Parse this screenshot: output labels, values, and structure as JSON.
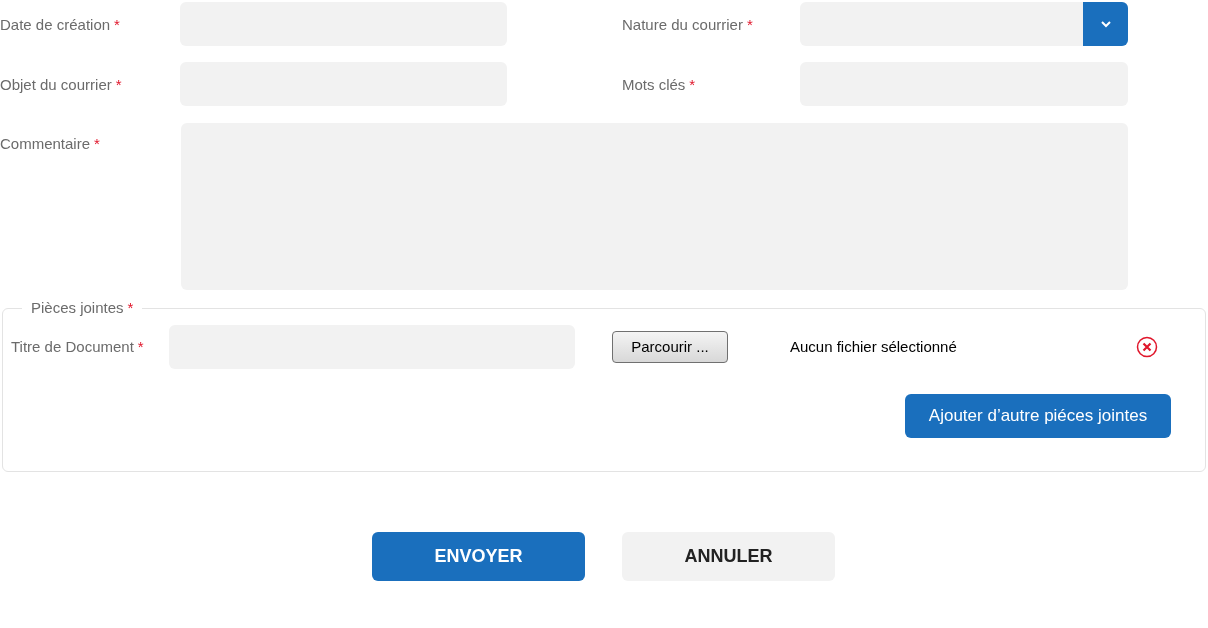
{
  "fields": [
    {
      "label": "Date de création",
      "required_mark": "*",
      "kind": "text"
    },
    {
      "label": "Nature du courrier",
      "required_mark": "*",
      "kind": "select"
    },
    {
      "label": "Objet du courrier",
      "required_mark": "*",
      "kind": "text"
    },
    {
      "label": "Mots clés",
      "required_mark": "*",
      "kind": "text"
    }
  ],
  "comment": {
    "label": "Commentaire",
    "required_mark": "*"
  },
  "attachments": {
    "legend": "Pièces jointes",
    "required_mark": "*",
    "title_label": "Titre de Document",
    "title_required_mark": "*",
    "browse_button": "Parcourir ...",
    "file_status": "Aucun fichier sélectionné",
    "add_button": "Ajouter d’autre piéces jointes"
  },
  "actions": [
    {
      "label": "ENVOYER",
      "kind": "primary"
    },
    {
      "label": "ANNULER",
      "kind": "secondary"
    }
  ]
}
